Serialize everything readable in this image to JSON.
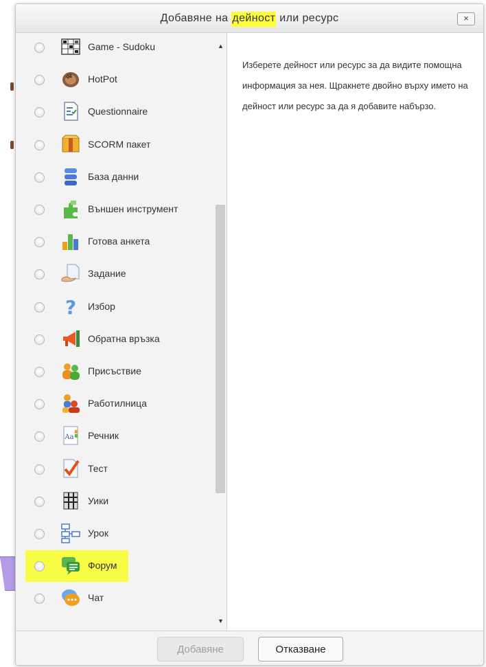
{
  "dialog": {
    "title_prefix": "Добавяне на ",
    "title_highlight": "дейност",
    "title_suffix": " или ресурс",
    "close_label": "×"
  },
  "activities": [
    {
      "label": "Game - Sudoku",
      "icon": "sudoku-grid-icon"
    },
    {
      "label": "HotPot",
      "icon": "hotpot-hand-icon"
    },
    {
      "label": "Questionnaire",
      "icon": "questionnaire-icon"
    },
    {
      "label": "SCORM пакет",
      "icon": "scorm-package-icon"
    },
    {
      "label": "База данни",
      "icon": "database-icon"
    },
    {
      "label": "Външен инструмент",
      "icon": "puzzle-piece-icon"
    },
    {
      "label": "Готова анкета",
      "icon": "bar-chart-icon"
    },
    {
      "label": "Задание",
      "icon": "assignment-icon"
    },
    {
      "label": "Избор",
      "icon": "question-mark-icon"
    },
    {
      "label": "Обратна връзка",
      "icon": "megaphone-icon"
    },
    {
      "label": "Присъствие",
      "icon": "attendance-people-icon"
    },
    {
      "label": "Работилница",
      "icon": "workshop-people-icon"
    },
    {
      "label": "Речник",
      "icon": "glossary-book-icon"
    },
    {
      "label": "Тест",
      "icon": "quiz-checkmark-icon"
    },
    {
      "label": "Уики",
      "icon": "wiki-puzzle-icon"
    },
    {
      "label": "Урок",
      "icon": "lesson-flowchart-icon"
    },
    {
      "label": "Форум",
      "icon": "forum-speech-bubbles-icon",
      "highlighted": true
    },
    {
      "label": "Чат",
      "icon": "chat-bubble-icon"
    }
  ],
  "help_text": "Изберете дейност или ресурс за да видите помощна информация за нея. Щракнете двойно върху името на дейност или ресурс за да я добавите набързо.",
  "buttons": {
    "add_label": "Добавяне",
    "add_disabled": true,
    "cancel_label": "Отказване"
  },
  "colors": {
    "highlight": "#f8fc45",
    "pointer": "#b59ae8"
  }
}
